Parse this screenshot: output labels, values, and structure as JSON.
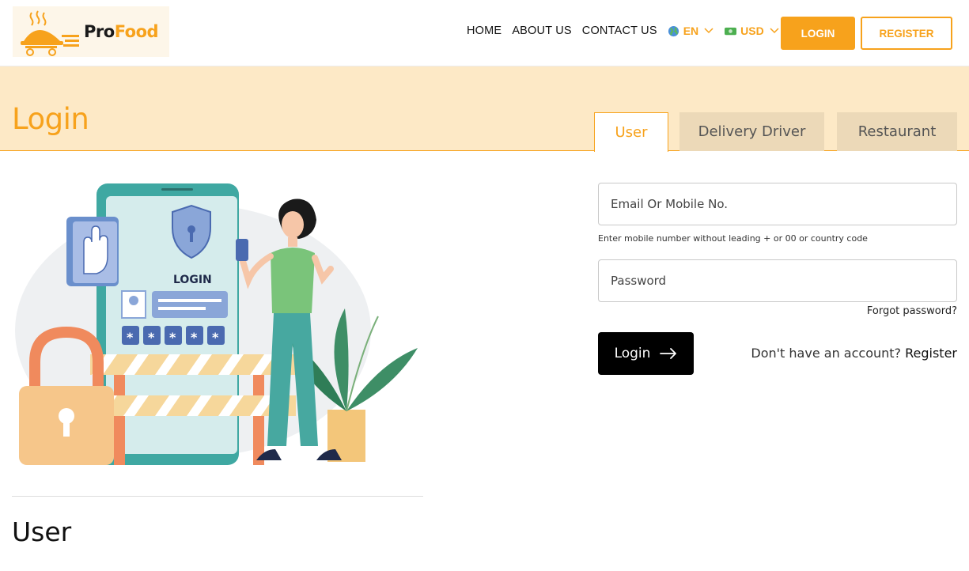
{
  "header": {
    "logo": {
      "pro": "Pro",
      "food": "Food"
    },
    "nav": [
      "HOME",
      "ABOUT US",
      "CONTACT US"
    ],
    "language": {
      "value": "EN",
      "icon": "globe-icon"
    },
    "currency": {
      "value": "USD",
      "icon": "money-icon"
    },
    "login_label": "LOGIN",
    "register_label": "REGISTER"
  },
  "banner": {
    "title": "Login",
    "tabs": [
      "User",
      "Delivery Driver",
      "Restaurant"
    ],
    "active_tab": "User"
  },
  "illustration": {
    "screen_label": "LOGIN"
  },
  "form": {
    "email_placeholder": "Email Or Mobile No.",
    "email_hint": "Enter mobile number without leading + or 00 or country code",
    "password_placeholder": "Password",
    "forgot_label": "Forgot password?",
    "submit_label": "Login",
    "no_account_text": "Don't have an account?",
    "register_link": "Register"
  },
  "section_title": "User",
  "colors": {
    "accent": "#f7a21c",
    "banner_bg": "#fde9c6",
    "dark": "#000000"
  }
}
